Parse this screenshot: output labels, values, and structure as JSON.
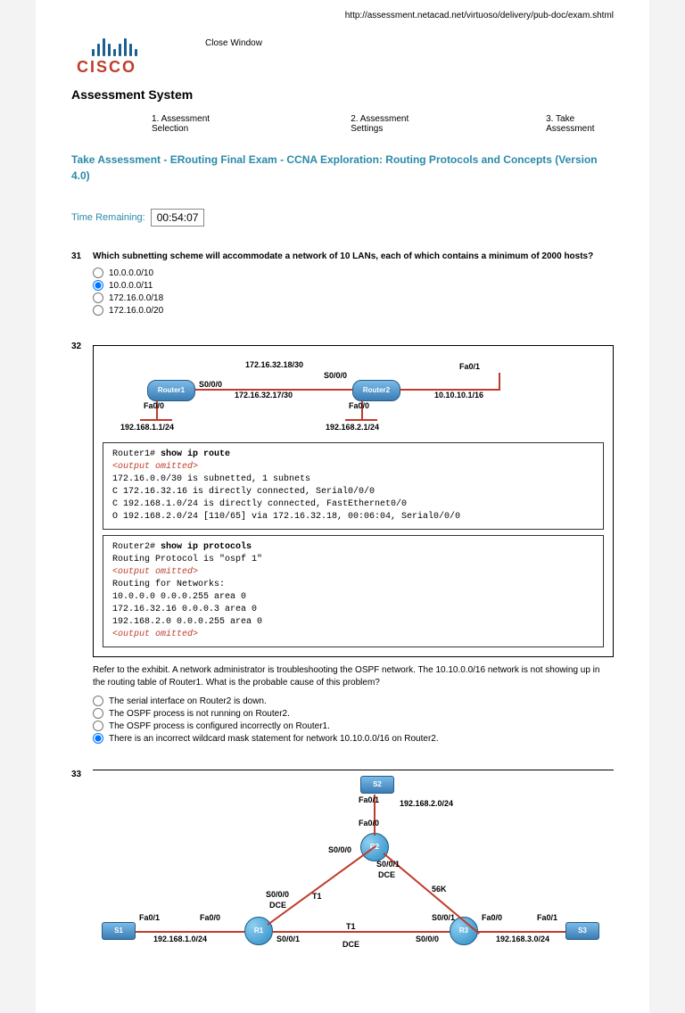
{
  "url": "http://assessment.netacad.net/virtuoso/delivery/pub-doc/exam.shtml",
  "logo": {
    "brand": "CISCO"
  },
  "close_window": "Close Window",
  "system_title": "Assessment System",
  "steps": {
    "s1": "1. Assessment Selection",
    "s2": "2. Assessment Settings",
    "s3": "3. Take Assessment"
  },
  "assessment_title": "Take Assessment - ERouting Final Exam - CCNA Exploration: Routing Protocols and Concepts (Version 4.0)",
  "time": {
    "label": "Time Remaining:",
    "value": "00:54:07"
  },
  "q31": {
    "num": "31",
    "text": "Which subnetting scheme will accommodate a network of 10 LANs, each of which contains a minimum of 2000 hosts?",
    "opts": [
      "10.0.0.0/10",
      "10.0.0.0/11",
      "172.16.0.0/18",
      "172.16.0.0/20"
    ],
    "selected": 1
  },
  "q32": {
    "num": "32",
    "diagram": {
      "r1": "Router1",
      "r2": "Router2",
      "top1": "172.16.32.18/30",
      "top2": "S0/0/0",
      "mid_left": "S0/0/0",
      "mid_right": "172.16.32.17/30",
      "r1_fa": "Fa0/0",
      "r1_ip": "192.168.1.1/24",
      "r2_fa0": "Fa0/0",
      "r2_ip0": "192.168.2.1/24",
      "r2_fa1": "Fa0/1",
      "r2_ip1": "10.10.10.1/16"
    },
    "term1": {
      "prompt": "Router1#",
      "cmd": "show ip route",
      "omit": "<output omitted>",
      "l1": "    172.16.0.0/30 is subnetted, 1 subnets",
      "l2": "C   172.16.32.16 is directly connected, Serial0/0/0",
      "l3": "C   192.168.1.0/24 is directly connected, FastEthernet0/0",
      "l4": "O   192.168.2.0/24 [110/65] via 172.16.32.18, 00:06:04, Serial0/0/0"
    },
    "term2": {
      "prompt": "Router2#",
      "cmd": "show ip protocols",
      "l0": "Routing Protocol is \"ospf 1\"",
      "omit": "<output omitted>",
      "l1": "  Routing for Networks:",
      "l2": "    10.0.0.0 0.0.0.255 area 0",
      "l3": "    172.16.32.16 0.0.0.3 area 0",
      "l4": "    192.168.2.0 0.0.0.255 area 0"
    },
    "ref": "Refer to the exhibit. A network administrator is troubleshooting the OSPF network. The 10.10.0.0/16 network is not showing up in the routing table of Router1. What is the probable cause of this problem?",
    "opts": [
      "The serial interface on Router2 is down.",
      "The OSPF process is not running on Router2.",
      "The OSPF process is configured incorrectly on Router1.",
      "There is an incorrect wildcard mask statement for network 10.10.0.0/16 on Router2."
    ],
    "selected": 3
  },
  "q33": {
    "num": "33",
    "labels": {
      "s1": "S1",
      "s2": "S2",
      "s3": "S3",
      "r1": "R1",
      "r2": "R2",
      "r3": "R3",
      "s2_net": "192.168.2.0/24",
      "s1_ip": "192.168.1.0/24",
      "s3_ip": "192.168.3.0/24",
      "fa01": "Fa0/1",
      "fa00": "Fa0/0",
      "s000": "S0/0/0",
      "s001": "S0/0/1",
      "dce": "DCE",
      "t1": "T1",
      "k56": "56K"
    }
  }
}
